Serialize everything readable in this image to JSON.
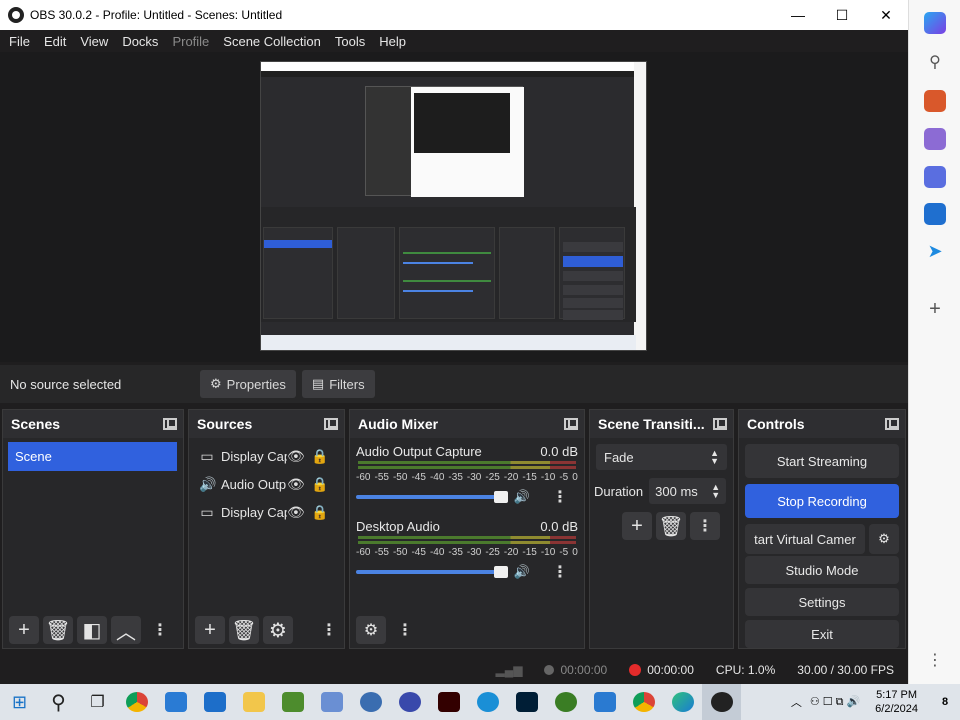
{
  "window": {
    "title": "OBS 30.0.2 - Profile: Untitled - Scenes: Untitled",
    "minimize": "—",
    "maximize": "☐",
    "close": "✕"
  },
  "menu": [
    {
      "label": "File"
    },
    {
      "label": "Edit"
    },
    {
      "label": "View"
    },
    {
      "label": "Docks"
    },
    {
      "label": "Profile",
      "disabled": true
    },
    {
      "label": "Scene Collection"
    },
    {
      "label": "Tools"
    },
    {
      "label": "Help"
    }
  ],
  "source_toolbar": {
    "no_source": "No source selected",
    "properties": "Properties",
    "filters": "Filters"
  },
  "scenes": {
    "title": "Scenes",
    "items": [
      {
        "label": "Scene",
        "selected": true
      }
    ]
  },
  "sources": {
    "title": "Sources",
    "items": [
      {
        "label": "Display Cap",
        "icon": "monitor-icon",
        "visible": true,
        "locked": false
      },
      {
        "label": "Audio Outp",
        "icon": "speaker-icon",
        "visible": true,
        "locked": false
      },
      {
        "label": "Display Cap",
        "icon": "monitor-icon",
        "visible": true,
        "locked": true
      }
    ]
  },
  "mixer": {
    "title": "Audio Mixer",
    "channels": [
      {
        "name": "Audio Output Capture",
        "db": "0.0 dB",
        "level": 0.96
      },
      {
        "name": "Desktop Audio",
        "db": "0.0 dB",
        "level": 0.96
      }
    ],
    "scale": [
      "-60",
      "-55",
      "-50",
      "-45",
      "-40",
      "-35",
      "-30",
      "-25",
      "-20",
      "-15",
      "-10",
      "-5",
      "0"
    ]
  },
  "transitions": {
    "title": "Scene Transiti...",
    "selected": "Fade",
    "duration_label": "Duration",
    "duration_value": "300 ms"
  },
  "controls": {
    "title": "Controls",
    "start_streaming": "Start Streaming",
    "stop_recording": "Stop Recording",
    "virtual_camera": "tart Virtual Camer",
    "studio_mode": "Studio Mode",
    "settings": "Settings",
    "exit": "Exit"
  },
  "status": {
    "stream_time": "00:00:00",
    "rec_time": "00:00:00",
    "cpu": "CPU: 1.0%",
    "fps": "30.00 / 30.00 FPS"
  },
  "taskbar": {
    "time": "5:17 PM",
    "date": "6/2/2024",
    "notif_count": "8"
  }
}
